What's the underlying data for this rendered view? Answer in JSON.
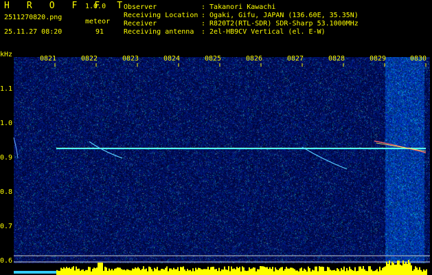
{
  "header": {
    "app_title": "H R O F F T",
    "version": "1.0.0",
    "filename": "2511270820.png",
    "meteor_label": "meteor",
    "datetime": "25.11.27 08:20",
    "meteor_count": "91",
    "info": [
      {
        "label": "Observer",
        "value": ": Takanori Kawachi"
      },
      {
        "label": "Receiving Location",
        "value": ": Ogaki, Gifu, JAPAN (136.60E, 35.35N)"
      },
      {
        "label": "Receiver",
        "value": ": R820T2(RTL-SDR) SDR-Sharp 53.1000MHz"
      },
      {
        "label": "Receiving antenna",
        "value": ": 2el-HB9CV Vertical (el. E-W)"
      }
    ]
  },
  "axis": {
    "unit": "kHz",
    "time_ticks": [
      "0821",
      "0822",
      "0823",
      "0824",
      "0825",
      "0826",
      "0827",
      "0828",
      "0829",
      "0830"
    ],
    "freq_ticks": [
      "1.1",
      "1.0",
      "0.9",
      "0.8",
      "0.7",
      "0.6"
    ]
  },
  "colors": {
    "background": "#000000",
    "label_yellow": "#ffff00",
    "label_green": "#00ff66",
    "noise_blue": "#1a2aa0",
    "carrier": "#40ffff",
    "activity_bar": "#ffff00",
    "baseline_cyan": "#33ccff"
  }
}
